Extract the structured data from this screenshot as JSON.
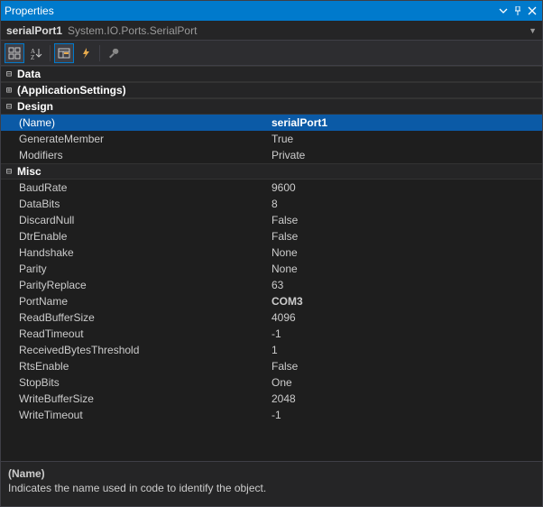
{
  "window": {
    "title": "Properties"
  },
  "object": {
    "name": "serialPort1",
    "type": "System.IO.Ports.SerialPort"
  },
  "categories": [
    {
      "label": "Data",
      "expanded": true,
      "items": []
    },
    {
      "label": "(ApplicationSettings)",
      "expanded": false,
      "items": [],
      "standalone": true
    },
    {
      "label": "Design",
      "expanded": true,
      "items": [
        {
          "label": "(Name)",
          "value": "serialPort1",
          "selected": true,
          "bold": true
        },
        {
          "label": "GenerateMember",
          "value": "True"
        },
        {
          "label": "Modifiers",
          "value": "Private"
        }
      ]
    },
    {
      "label": "Misc",
      "expanded": true,
      "items": [
        {
          "label": "BaudRate",
          "value": "9600"
        },
        {
          "label": "DataBits",
          "value": "8"
        },
        {
          "label": "DiscardNull",
          "value": "False"
        },
        {
          "label": "DtrEnable",
          "value": "False"
        },
        {
          "label": "Handshake",
          "value": "None"
        },
        {
          "label": "Parity",
          "value": "None"
        },
        {
          "label": "ParityReplace",
          "value": "63"
        },
        {
          "label": "PortName",
          "value": "COM3",
          "bold": true
        },
        {
          "label": "ReadBufferSize",
          "value": "4096"
        },
        {
          "label": "ReadTimeout",
          "value": "-1"
        },
        {
          "label": "ReceivedBytesThreshold",
          "value": "1"
        },
        {
          "label": "RtsEnable",
          "value": "False"
        },
        {
          "label": "StopBits",
          "value": "One"
        },
        {
          "label": "WriteBufferSize",
          "value": "2048"
        },
        {
          "label": "WriteTimeout",
          "value": "-1"
        }
      ]
    }
  ],
  "description": {
    "title": "(Name)",
    "text": "Indicates the name used in code to identify the object."
  },
  "glyph": {
    "minus": "⊟",
    "plus": "⊞"
  }
}
